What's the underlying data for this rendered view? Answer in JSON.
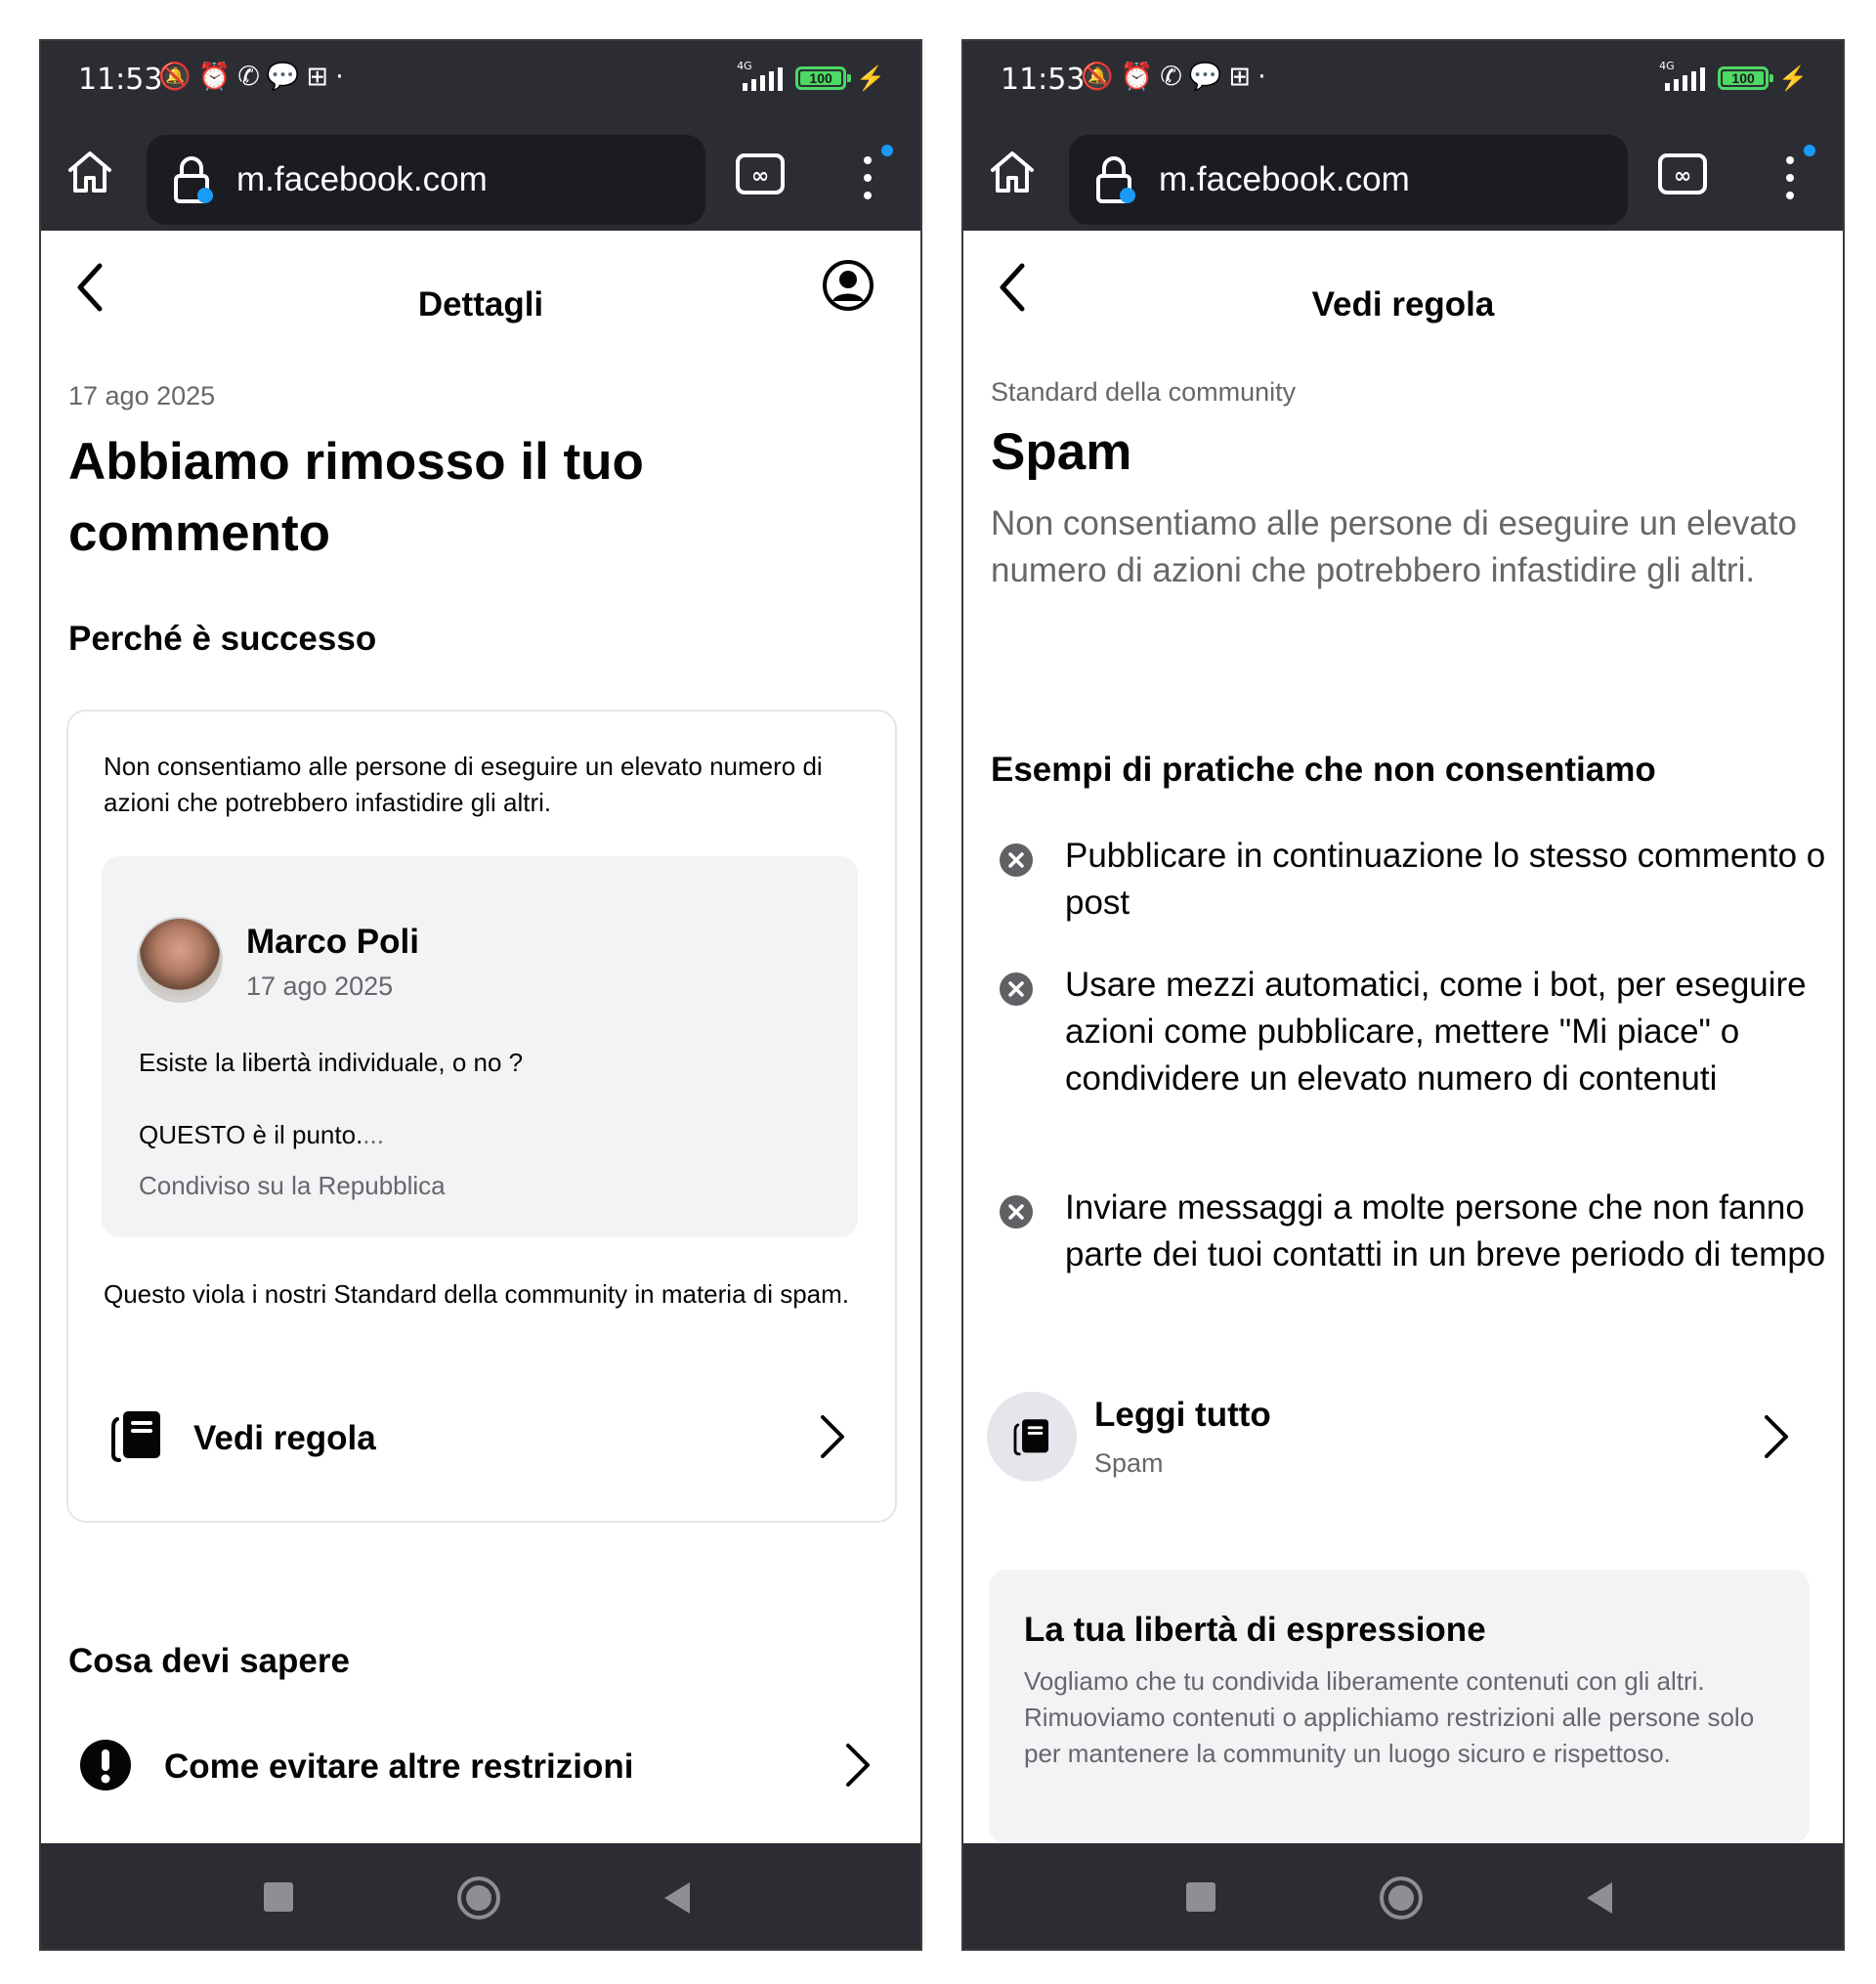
{
  "status_bar": {
    "time": "11:53",
    "notification_icons": [
      "bell-off-icon",
      "alarm-icon",
      "whatsapp-icon",
      "chat-bubble-icon",
      "apps-grid-icon",
      "dot-icon"
    ],
    "notification_glyphs": "🔕⏰✆💬⊞·",
    "network": "4G",
    "battery": "100",
    "battery_level": 1.0
  },
  "browser": {
    "url": "m.facebook.com",
    "menu_badge_color": "#1a9bf7"
  },
  "left_screen": {
    "header_title": "Dettagli",
    "date": "17 ago 2025",
    "title": "Abbiamo rimosso il tuo commento",
    "why_heading": "Perché è successo",
    "card": {
      "description": "Non consentiamo alle persone di eseguire un elevato numero di azioni che potrebbero infastidire gli altri.",
      "comment": {
        "author": "Marco Poli",
        "date": "17 ago 2025",
        "line1": "Esiste la libertà individuale, o no ?",
        "line2": "QUESTO è il punto.",
        "line2_ellipsis": "...",
        "shared": "Condiviso su la Repubblica"
      },
      "violation": "Questo viola i nostri Standard della community in materia di spam.",
      "view_rule": "Vedi regola"
    },
    "know_heading": "Cosa devi sapere",
    "avoid_label": "Come evitare altre restrizioni"
  },
  "right_screen": {
    "header_title": "Vedi regola",
    "category": "Standard della community",
    "title": "Spam",
    "description": "Non consentiamo alle persone di eseguire un elevato numero di azioni che potrebbero infastidire gli altri.",
    "examples_heading": "Esempi di pratiche che non consentiamo",
    "examples": [
      "Pubblicare in continuazione lo stesso commento o post",
      "Usare mezzi automatici, come i bot, per eseguire azioni come pubblicare, mettere \"Mi piace\" o condividere un elevato numero di contenuti",
      "Inviare messaggi a molte persone che non fanno parte dei tuoi contatti in un breve periodo di tempo"
    ],
    "read_all": {
      "label": "Leggi tutto",
      "sub": "Spam"
    },
    "freedom": {
      "title": "La tua libertà di espressione",
      "text": "Vogliamo che tu condivida liberamente contenuti con gli altri. Rimuoviamo contenuti o applichiamo restrizioni alle persone solo per mantenere la community un luogo sicuro e rispettoso."
    }
  },
  "colors": {
    "chrome_dark": "#2c2d33",
    "url_bar": "#1b1c21",
    "text_primary": "#050505",
    "text_secondary": "#65676b",
    "card_gray": "#f2f3f5",
    "battery_green": "#4cd964"
  }
}
